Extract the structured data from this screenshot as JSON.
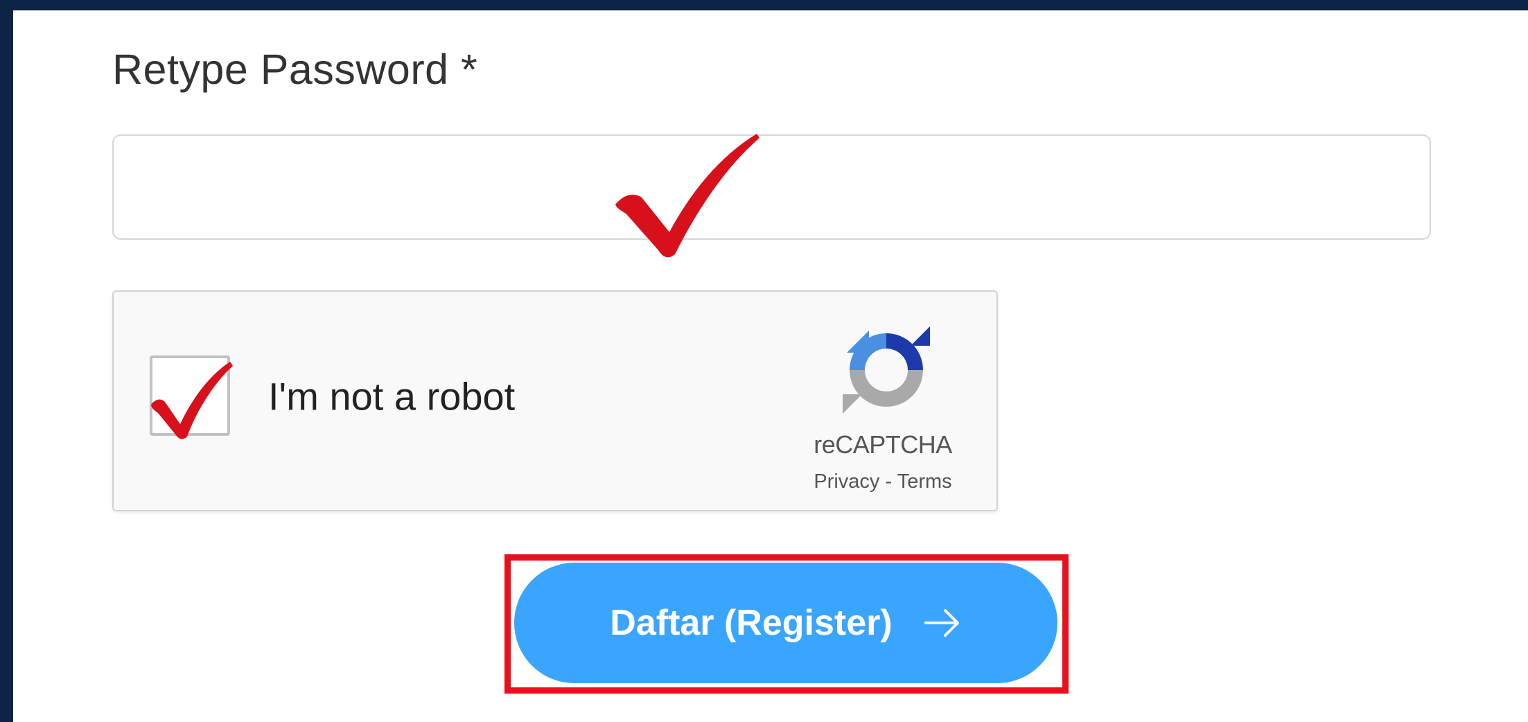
{
  "form": {
    "retype_password_label": "Retype Password *",
    "retype_password_value": ""
  },
  "recaptcha": {
    "checkbox_label": "I'm not a robot",
    "checked": true,
    "brand": "reCAPTCHA",
    "privacy_link": "Privacy",
    "separator": "-",
    "terms_link": "Terms",
    "icon": "recaptcha-logo-icon"
  },
  "submit": {
    "label": "Daftar (Register)",
    "icon": "arrow-right-icon"
  },
  "colors": {
    "page_background": "#0d2447",
    "button_background": "#3aa5ff",
    "annotation_red": "#e8101c",
    "checkmark_red": "#d8101c"
  }
}
